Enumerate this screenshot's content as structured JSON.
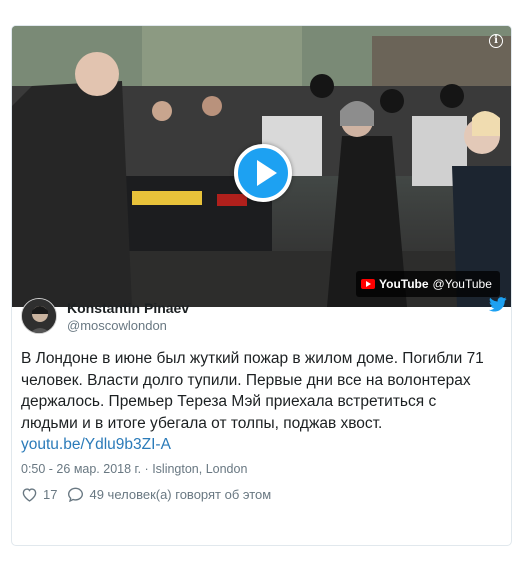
{
  "media": {
    "youtube_brand": "YouTube",
    "youtube_channel": "@YouTube",
    "icons": {
      "info": "info-icon",
      "play": "play-icon",
      "youtube": "youtube-logo-icon"
    }
  },
  "author": {
    "display_name": "Konstantin Pinaev",
    "handle": "@moscowlondon"
  },
  "tweet": {
    "text": "В Лондоне в июне был жуткий пожар в жилом доме. Погибли 71 человек. Власти долго тупили. Первые дни все на волонтерах держалось. Премьер Тереза Мэй приехала встретиться с людьми и в итоге убегала от толпы, поджав хвост.",
    "link": "youtu.be/Ydlu9b3ZI-A",
    "time": "0:50 - 26 мар. 2018 г.",
    "separator": "·",
    "location": "Islington, London"
  },
  "actions": {
    "likes": "17",
    "replies_text": "49 человек(а) говорят об этом"
  },
  "colors": {
    "twitter_blue": "#1da1f2",
    "link": "#2b7bb9",
    "secondary_text": "#697882",
    "border": "#e1e8ed",
    "youtube_red": "#ff0000"
  }
}
